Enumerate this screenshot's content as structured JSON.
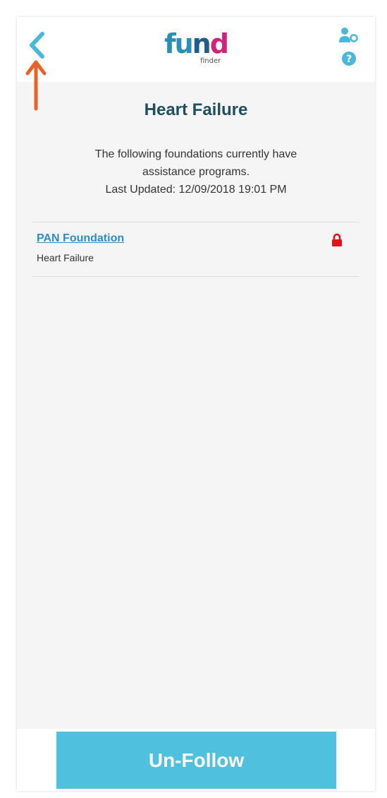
{
  "header": {
    "logo_text": "fund",
    "logo_subtext": "finder",
    "back_icon": "chevron-left-icon",
    "profile_icon": "user-settings-icon",
    "help_icon": "question-circle-icon"
  },
  "page": {
    "title": "Heart Failure",
    "intro_line1": "The following foundations currently have",
    "intro_line2": "assistance programs.",
    "last_updated": "Last Updated: 12/09/2018 19:01 PM"
  },
  "foundations": [
    {
      "name": "PAN Foundation",
      "disease": "Heart Failure",
      "icon": "lock-icon"
    }
  ],
  "footer": {
    "unfollow_label": "Un-Follow"
  },
  "colors": {
    "accent": "#4fc0dd",
    "title": "#1f4e63",
    "link": "#2a8ec7",
    "lock": "#e0141e",
    "annotation_arrow": "#e8632a"
  }
}
